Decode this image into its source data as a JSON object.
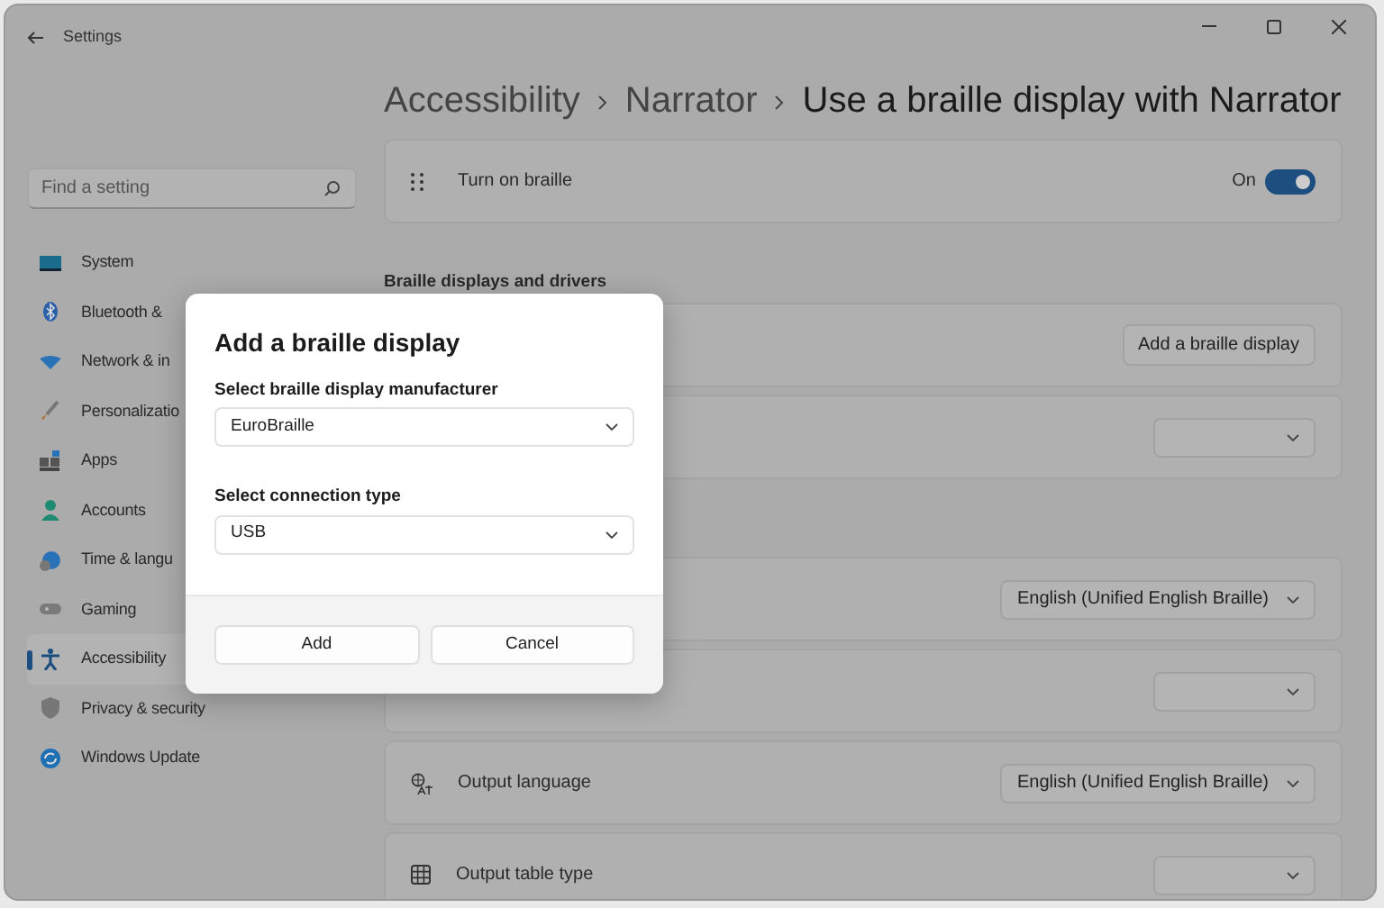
{
  "window": {
    "title": "Settings"
  },
  "breadcrumb": [
    {
      "label": "Accessibility",
      "current": false
    },
    {
      "label": "Narrator",
      "current": false
    },
    {
      "label": "Use a braille display with Narrator",
      "current": true
    }
  ],
  "search": {
    "placeholder": "Find a setting"
  },
  "sidebar": {
    "items": [
      {
        "label": "System",
        "selected": false
      },
      {
        "label": "Bluetooth &",
        "selected": false
      },
      {
        "label": "Network & in",
        "selected": false
      },
      {
        "label": "Personalizatio",
        "selected": false
      },
      {
        "label": "Apps",
        "selected": false
      },
      {
        "label": "Accounts",
        "selected": false
      },
      {
        "label": "Time & langu",
        "selected": false
      },
      {
        "label": "Gaming",
        "selected": false
      },
      {
        "label": "Accessibility",
        "selected": true
      },
      {
        "label": "Privacy & security",
        "selected": false
      },
      {
        "label": "Windows Update",
        "selected": false
      }
    ]
  },
  "braille_toggle": {
    "label": "Turn on braille",
    "state_label": "On",
    "on": true
  },
  "groups": [
    {
      "title": "Braille displays and drivers",
      "rows": [
        {
          "kind": "button",
          "button": "Add a braille display"
        },
        {
          "kind": "dropdown"
        }
      ]
    },
    {
      "rows": [
        {
          "kind": "dropdown",
          "value": "English (Unified English Braille)"
        },
        {
          "kind": "dropdown"
        },
        {
          "kind": "dropdown",
          "label": "Output language",
          "value": "English (Unified English Braille)"
        },
        {
          "kind": "dropdown",
          "label": "Output table type"
        }
      ]
    }
  ],
  "dialog": {
    "title": "Add a braille display",
    "fields": [
      {
        "label": "Select braille display manufacturer",
        "value": "EuroBraille"
      },
      {
        "label": "Select connection type",
        "value": "USB"
      }
    ],
    "buttons": [
      "Add",
      "Cancel"
    ]
  }
}
